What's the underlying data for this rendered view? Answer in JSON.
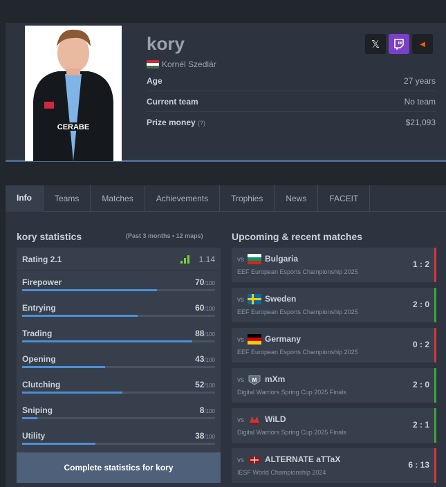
{
  "colors": {
    "accent": "#4d8fd6",
    "win": "#3ea53a",
    "loss": "#d9363e",
    "twitch": "#7a40c9",
    "faceit": "#ff5500"
  },
  "player": {
    "nick": "kory",
    "real_name": "Kornél Szedlár",
    "flag": "hungary-flag",
    "photo_icon": "player-photo"
  },
  "socials": [
    {
      "icon": "x-icon",
      "glyph": "𝕏"
    },
    {
      "icon": "twitch-icon",
      "glyph": ""
    },
    {
      "icon": "faceit-icon",
      "glyph": "◄"
    }
  ],
  "info": {
    "age_label": "Age",
    "age_value": "27 years",
    "team_label": "Current team",
    "team_value": "No team",
    "prize_label": "Prize money",
    "prize_hint": "(?)",
    "prize_value": "$21,093"
  },
  "tabs": [
    "Info",
    "Teams",
    "Matches",
    "Achievements",
    "Trophies",
    "News",
    "FACEIT"
  ],
  "stats": {
    "title": "kory statistics",
    "period": "(Past 3 months • 12 maps)",
    "rating_label": "Rating 2.1",
    "rating_value": "1.14",
    "max_suffix": "/100",
    "items": [
      {
        "label": "Firepower",
        "value": 70
      },
      {
        "label": "Entrying",
        "value": 60
      },
      {
        "label": "Trading",
        "value": 88
      },
      {
        "label": "Opening",
        "value": 43
      },
      {
        "label": "Clutching",
        "value": 52
      },
      {
        "label": "Sniping",
        "value": 8
      },
      {
        "label": "Utility",
        "value": 38
      }
    ],
    "button": "Complete statistics for kory"
  },
  "matches": {
    "title": "Upcoming & recent matches",
    "vs": "vs",
    "items": [
      {
        "team": "Bulgaria",
        "icon": "bulgaria-flag",
        "event": "EEF European Esports Championship 2025",
        "score": "1 : 2",
        "result": "loss"
      },
      {
        "team": "Sweden",
        "icon": "sweden-flag",
        "event": "EEF European Esports Championship 2025",
        "score": "2 : 0",
        "result": "win"
      },
      {
        "team": "Germany",
        "icon": "germany-flag",
        "event": "EEF European Esports Championship 2025",
        "score": "0 : 2",
        "result": "loss"
      },
      {
        "team": "mXm",
        "icon": "mxm-logo",
        "event": "Digital Warriors Spring Cup 2025 Finals",
        "score": "2 : 0",
        "result": "win"
      },
      {
        "team": "WiLD",
        "icon": "wild-logo",
        "event": "Digital Warriors Spring Cup 2025 Finals",
        "score": "2 : 1",
        "result": "win"
      },
      {
        "team": "ALTERNATE aTTaX",
        "icon": "attax-logo",
        "event": "IESF World Championship 2024",
        "score": "6 : 13",
        "result": "loss"
      }
    ]
  }
}
